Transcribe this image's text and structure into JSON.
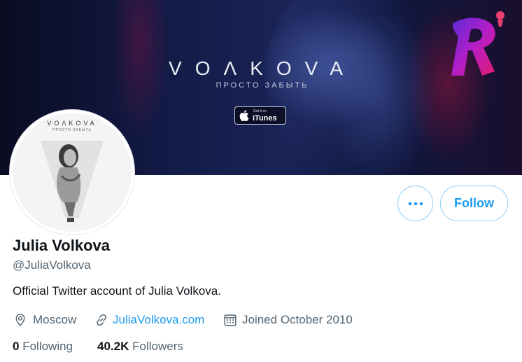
{
  "banner": {
    "brand": "VOΛKOVA",
    "subtitle": "ПРОСТО ЗАБЫТЬ",
    "itunes_small": "Get it on",
    "itunes_label": "iTunes"
  },
  "avatar": {
    "brand": "VOΛKOVA",
    "subtitle": "ПРОСТО ЗАБЫТЬ"
  },
  "actions": {
    "more_icon": "more-dots-icon",
    "follow_label": "Follow"
  },
  "profile": {
    "name": "Julia Volkova",
    "handle": "@JuliaVolkova",
    "bio": "Official Twitter account of Julia Volkova.",
    "location": "Moscow",
    "website": "JuliaVolkova.com",
    "joined": "Joined October 2010"
  },
  "stats": {
    "following_count": "0",
    "following_label": "Following",
    "followers_count": "40.2K",
    "followers_label": "Followers"
  },
  "colors": {
    "accent": "#1d9bf0",
    "secondary_text": "#536471",
    "primary_text": "#0f1419",
    "button_border": "#8ecdf7"
  }
}
